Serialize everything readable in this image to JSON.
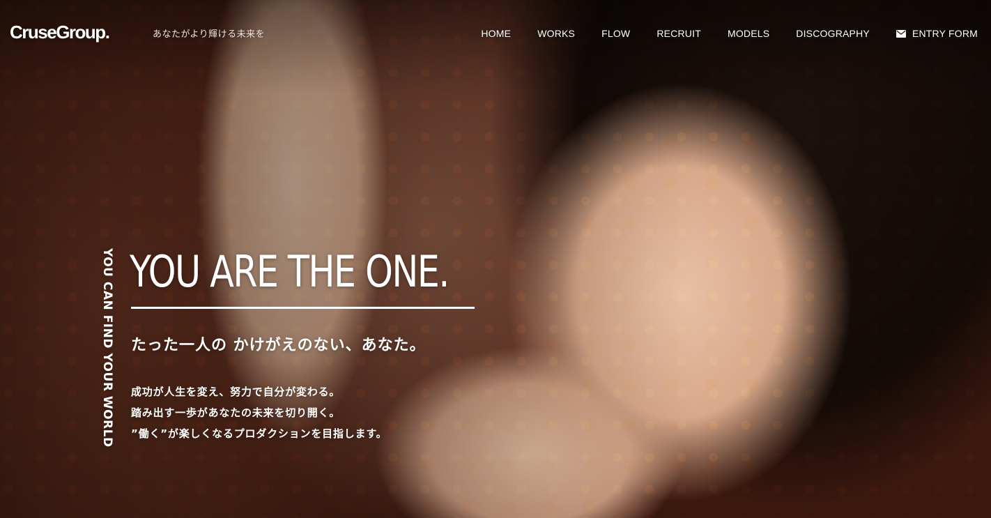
{
  "brand": {
    "logo_text": "CruseGroup",
    "logo_suffix": ".",
    "tagline": "あなたがより輝ける未来を"
  },
  "nav": {
    "items": [
      {
        "label": "HOME"
      },
      {
        "label": "WORKS"
      },
      {
        "label": "FLOW"
      },
      {
        "label": "RECRUIT"
      },
      {
        "label": "MODELS"
      },
      {
        "label": "DISCOGRAPHY"
      }
    ],
    "entry": {
      "label": "ENTRY FORM",
      "icon": "mail-icon"
    }
  },
  "hero": {
    "vertical_text": "YOU CAN FIND YOUR WORLD",
    "headline": "YOU ARE THE ONE.",
    "subheadline": "たった一人の かけがえのない、あなた。",
    "body_lines": [
      "成功が人生を変え、努力で自分が変わる。",
      "踏み出す一歩があなたの未来を切り開く。",
      "”働く”が楽しくなるプロダクションを目指します。"
    ]
  },
  "colors": {
    "text": "#ffffff",
    "tagline": "#f1e6df",
    "background_dark": "#1a0d08",
    "sofa_red": "#5a2919"
  }
}
